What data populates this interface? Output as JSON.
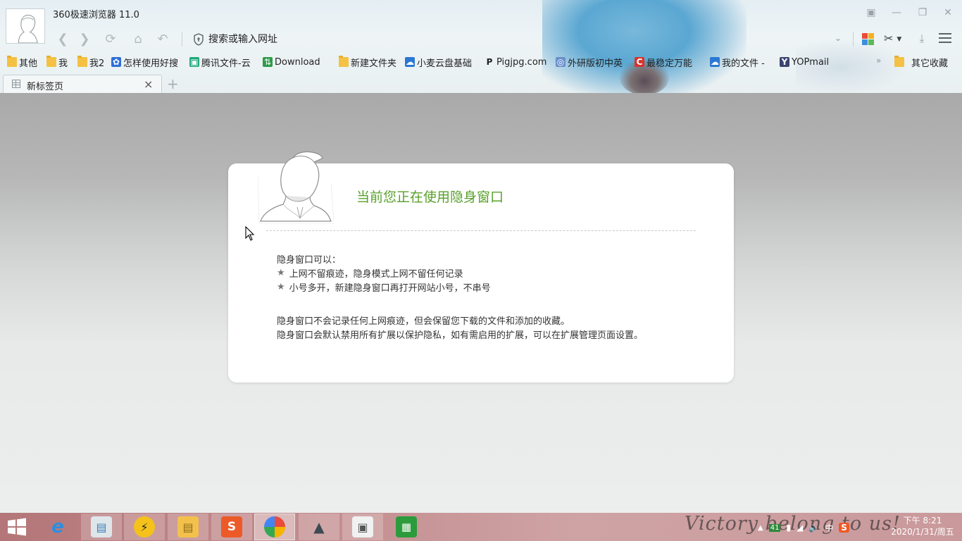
{
  "window": {
    "title": "360极速浏览器 11.0"
  },
  "toolbar": {
    "address_placeholder": "搜索或输入网址"
  },
  "bookmarks": {
    "items": [
      {
        "label": "其他",
        "icon": "folder-icon"
      },
      {
        "label": "我",
        "icon": "folder-icon"
      },
      {
        "label": "我2",
        "icon": "folder-icon"
      },
      {
        "label": "怎样使用好搜",
        "icon": "baidu-paw-icon"
      },
      {
        "label": "腾讯文件-云",
        "icon": "tencent-doc-icon"
      },
      {
        "label": "Download",
        "icon": "download-site-icon"
      },
      {
        "label": "新建文件夹",
        "icon": "folder-icon"
      },
      {
        "label": "小麦云盘基础",
        "icon": "cloud-icon"
      },
      {
        "label": "Pigjpg.com",
        "icon": "p-letter-icon"
      },
      {
        "label": "外研版初中英",
        "icon": "globe-icon"
      },
      {
        "label": "最稳定万能",
        "icon": "c-logo-icon"
      },
      {
        "label": "我的文件 -",
        "icon": "cloud-icon"
      },
      {
        "label": "YOPmail",
        "icon": "yopmail-icon"
      }
    ],
    "more_label": "»",
    "other_label": "其它收藏"
  },
  "tabs": [
    {
      "label": "新标签页",
      "active": true
    }
  ],
  "incognito": {
    "title": "当前您正在使用隐身窗口",
    "can_heading": "隐身窗口可以：",
    "features": [
      "上网不留痕迹，隐身模式上网不留任何记录",
      "小号多开，新建隐身窗口再打开网站小号，不串号"
    ],
    "notes": [
      "隐身窗口不会记录任何上网痕迹，但会保留您下载的文件和添加的收藏。",
      "隐身窗口会默认禁用所有扩展以保护隐私，如有需启用的扩展，可以在扩展管理页面设置。"
    ],
    "accent_color": "#58a02b"
  },
  "taskbar": {
    "apps": [
      {
        "name": "internet-explorer",
        "icon": "ie-icon"
      },
      {
        "name": "resource-monitor",
        "icon": "monitor-chart-icon"
      },
      {
        "name": "speed-app",
        "icon": "lightning-icon"
      },
      {
        "name": "file-explorer",
        "icon": "folder-icon"
      },
      {
        "name": "sogou-input",
        "icon": "sogou-s-icon"
      },
      {
        "name": "360-browser",
        "icon": "360-browser-icon"
      },
      {
        "name": "mountain-app",
        "icon": "mountain-icon"
      },
      {
        "name": "remote-desktop",
        "icon": "screen-icon"
      },
      {
        "name": "green-app",
        "icon": "green-film-icon"
      }
    ],
    "wallpaper_text": "Victory belong to us!",
    "tray": {
      "badge": "41",
      "ime": "中",
      "sogou": "S"
    },
    "clock": {
      "time": "下午 8:21",
      "date": "2020/1/31/周五"
    }
  }
}
